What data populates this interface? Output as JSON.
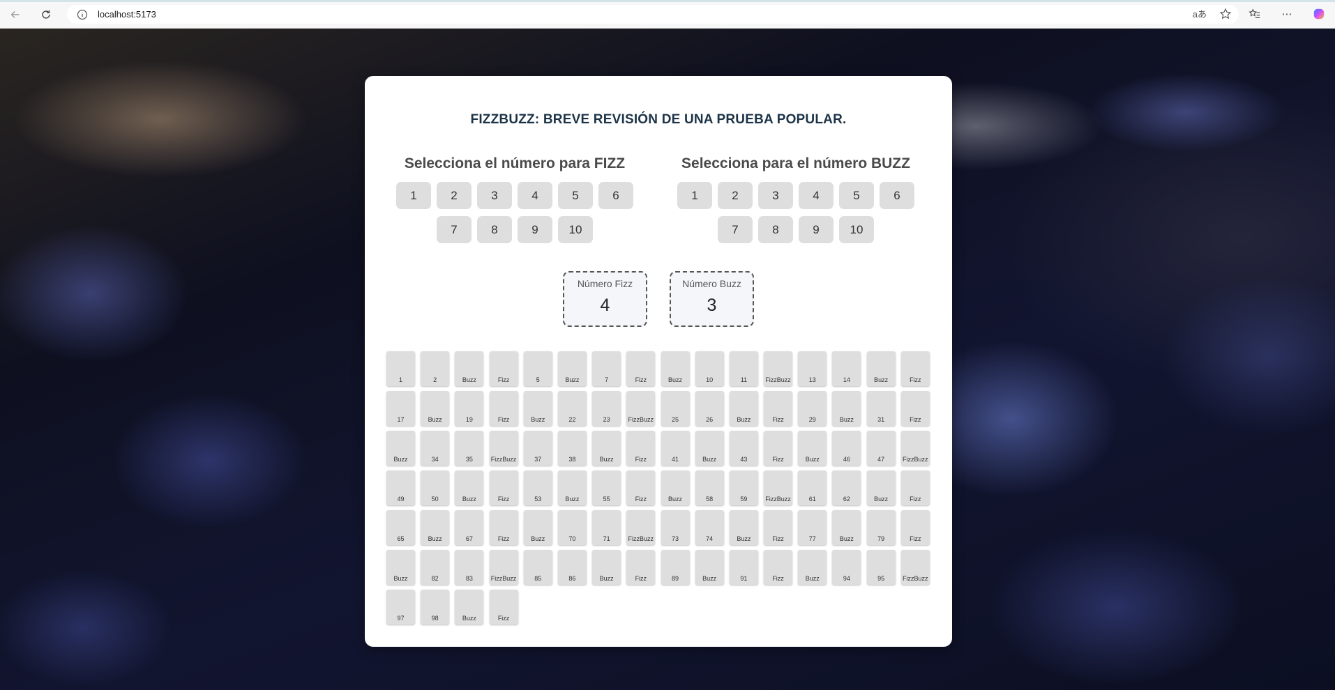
{
  "browser": {
    "url": "localhost:5173",
    "icons": [
      "back-arrow-icon",
      "reload-icon",
      "info-icon",
      "read-aloud-icon",
      "favorite-star-icon",
      "favorites-icon",
      "more-icon",
      "copilot-icon"
    ]
  },
  "app": {
    "title": "FIZZBUZZ: BREVE REVISIÓN DE UNA PRUEBA POPULAR.",
    "fizz_picker": {
      "title": "Selecciona el número para FIZZ",
      "options": [
        "1",
        "2",
        "3",
        "4",
        "5",
        "6",
        "7",
        "8",
        "9",
        "10"
      ]
    },
    "buzz_picker": {
      "title": "Selecciona para el número BUZZ",
      "options": [
        "1",
        "2",
        "3",
        "4",
        "5",
        "6",
        "7",
        "8",
        "9",
        "10"
      ]
    },
    "fizz_display": {
      "label": "Número Fizz",
      "value": "4"
    },
    "buzz_display": {
      "label": "Número Buzz",
      "value": "3"
    },
    "results": [
      "1",
      "2",
      "Buzz",
      "Fizz",
      "5",
      "Buzz",
      "7",
      "Fizz",
      "Buzz",
      "10",
      "11",
      "FizzBuzz",
      "13",
      "14",
      "Buzz",
      "Fizz",
      "17",
      "Buzz",
      "19",
      "Fizz",
      "Buzz",
      "22",
      "23",
      "FizzBuzz",
      "25",
      "26",
      "Buzz",
      "Fizz",
      "29",
      "Buzz",
      "31",
      "Fizz",
      "Buzz",
      "34",
      "35",
      "FizzBuzz",
      "37",
      "38",
      "Buzz",
      "Fizz",
      "41",
      "Buzz",
      "43",
      "Fizz",
      "Buzz",
      "46",
      "47",
      "FizzBuzz",
      "49",
      "50",
      "Buzz",
      "Fizz",
      "53",
      "Buzz",
      "55",
      "Fizz",
      "Buzz",
      "58",
      "59",
      "FizzBuzz",
      "61",
      "62",
      "Buzz",
      "Fizz",
      "65",
      "Buzz",
      "67",
      "Fizz",
      "Buzz",
      "70",
      "71",
      "FizzBuzz",
      "73",
      "74",
      "Buzz",
      "Fizz",
      "77",
      "Buzz",
      "79",
      "Fizz",
      "Buzz",
      "82",
      "83",
      "FizzBuzz",
      "85",
      "86",
      "Buzz",
      "Fizz",
      "89",
      "Buzz",
      "91",
      "Fizz",
      "Buzz",
      "94",
      "95",
      "FizzBuzz",
      "97",
      "98",
      "Buzz",
      "Fizz"
    ]
  }
}
